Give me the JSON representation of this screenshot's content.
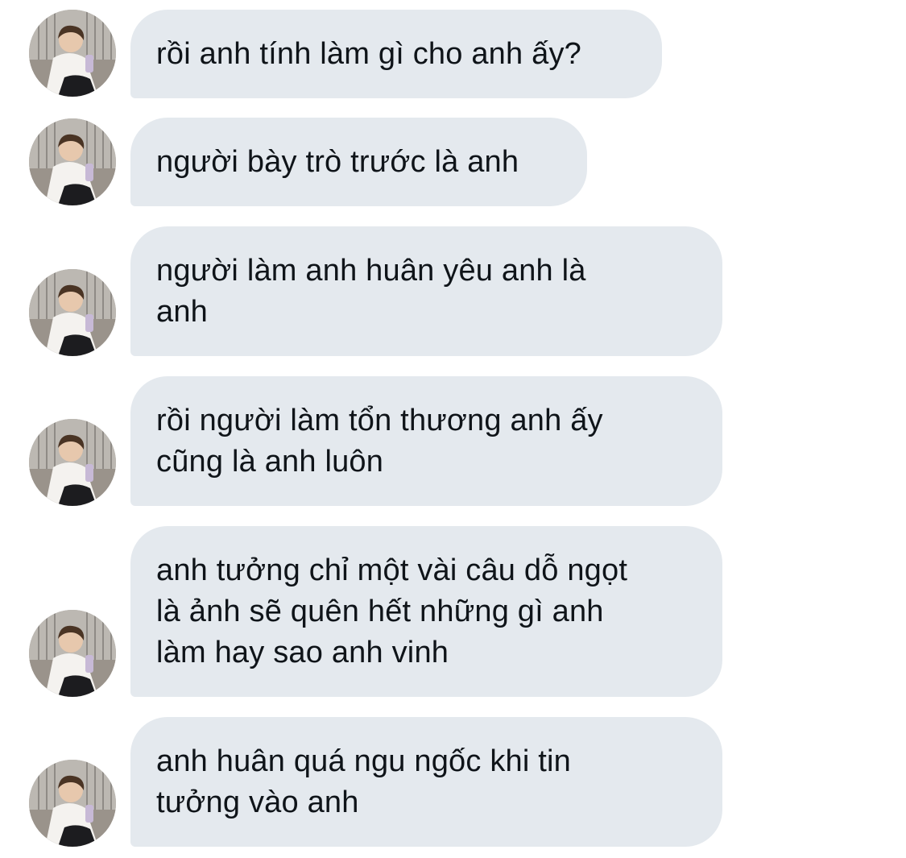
{
  "conversation": {
    "messages": [
      {
        "text": "rồi anh tính làm gì cho anh ấy?"
      },
      {
        "text": "người bày trò trước là anh"
      },
      {
        "text": "người làm anh huân yêu anh là\nanh"
      },
      {
        "text": "rồi người làm tổn thương anh ấy\ncũng là anh luôn"
      },
      {
        "text": "anh tưởng chỉ một vài câu dỗ ngọt\nlà ảnh sẽ quên hết những gì anh\nlàm hay sao anh vinh"
      },
      {
        "text": "anh huân quá ngu ngốc khi tin\ntưởng vào anh"
      }
    ]
  },
  "colors": {
    "bubble_background": "#e4e9ee",
    "text": "#0f1419",
    "page_background": "#ffffff"
  }
}
